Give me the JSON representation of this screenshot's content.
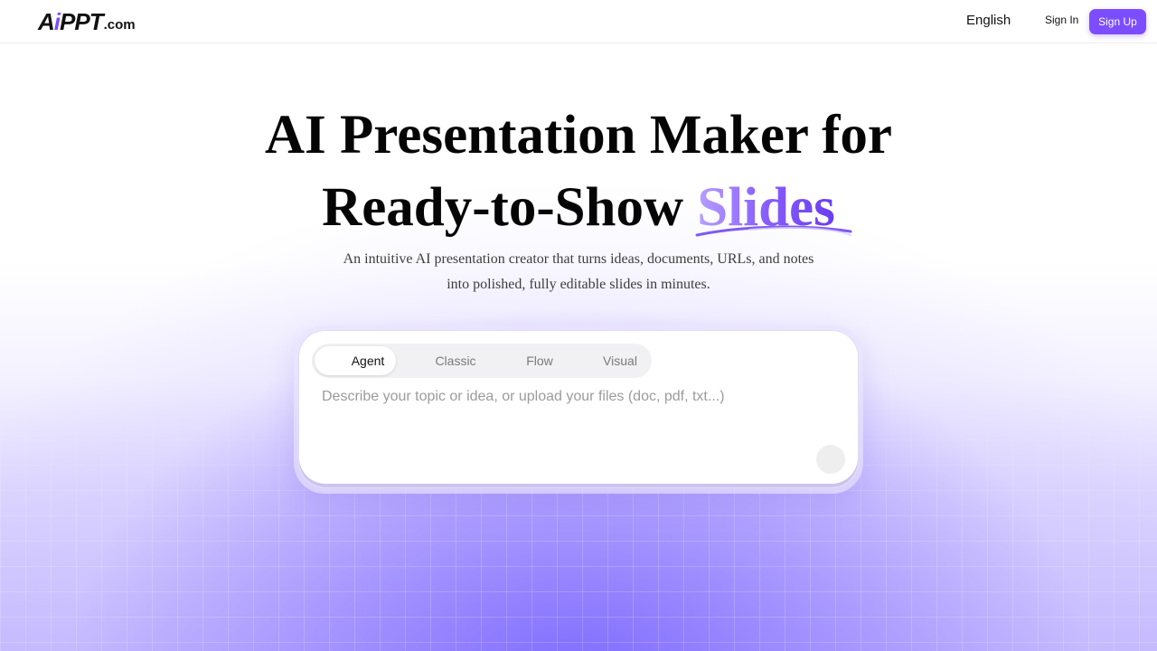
{
  "header": {
    "logo": {
      "a": "A",
      "i": "i",
      "ppt": "PPT",
      "com": ".com"
    },
    "language": "English",
    "sign_in": "Sign In",
    "sign_up": "Sign Up"
  },
  "hero": {
    "title_line1": "AI Presentation Maker for",
    "title_line2_prefix": "Ready-to-Show ",
    "title_highlight": "Slides",
    "subtitle_line1": "An intuitive AI presentation creator that turns ideas, documents, URLs, and notes",
    "subtitle_line2": "into polished, fully editable slides in minutes."
  },
  "composer": {
    "tabs": [
      {
        "label": "Agent",
        "active": true
      },
      {
        "label": "Classic",
        "active": false
      },
      {
        "label": "Flow",
        "active": false
      },
      {
        "label": "Visual",
        "active": false
      }
    ],
    "placeholder": "Describe your topic or idea, or upload your files (doc, pdf, txt...)",
    "value": ""
  },
  "colors": {
    "accent": "#7c4dff",
    "highlight_gradient_start": "#b7a0ff",
    "highlight_gradient_end": "#6a3cf0"
  }
}
